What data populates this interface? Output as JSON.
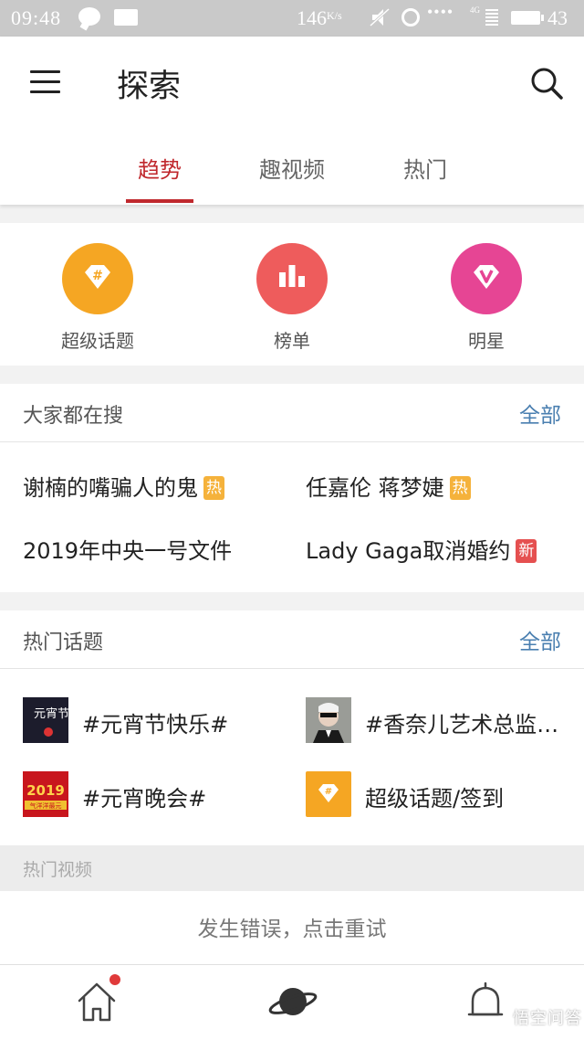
{
  "status_bar": {
    "time": "09:48",
    "net_speed": "146",
    "net_speed_unit": "K/s",
    "signal_label": "4G",
    "battery": "43"
  },
  "header": {
    "title": "探索",
    "tabs": [
      {
        "label": "趋势",
        "active": true
      },
      {
        "label": "趣视频",
        "active": false
      },
      {
        "label": "热门",
        "active": false
      }
    ]
  },
  "quick_entries": [
    {
      "label": "超级话题",
      "icon": "hashtag-diamond-icon",
      "color": "#f5a623"
    },
    {
      "label": "榜单",
      "icon": "bar-chart-icon",
      "color": "#ee5c5c"
    },
    {
      "label": "明星",
      "icon": "v-diamond-icon",
      "color": "#e64594"
    }
  ],
  "trending_search": {
    "title": "大家都在搜",
    "all_label": "全部",
    "items": [
      {
        "text": "谢楠的嘴骗人的鬼",
        "badge": "热",
        "badge_type": "hot"
      },
      {
        "text": "任嘉伦 蒋梦婕",
        "badge": "热",
        "badge_type": "hot"
      },
      {
        "text": "2019年中央一号文件",
        "badge": "",
        "badge_type": ""
      },
      {
        "text": "Lady Gaga取消婚约",
        "badge": "新",
        "badge_type": "new"
      }
    ]
  },
  "hot_topics": {
    "title": "热门话题",
    "all_label": "全部",
    "items": [
      {
        "text": "#元宵节快乐#",
        "thumb": "lantern-festival-thumbnail"
      },
      {
        "text": "#香奈儿艺术总监…",
        "thumb": "person-sunglasses-thumbnail"
      },
      {
        "text": "#元宵晚会#",
        "thumb": "2019-gala-thumbnail"
      },
      {
        "text": "超级话题/签到",
        "thumb": "hashtag-diamond-icon"
      }
    ],
    "thumb_texts": {
      "lantern": "元宵节",
      "gala_year": "2019",
      "gala_banner": "气洋洋最元"
    }
  },
  "hot_videos": {
    "title": "热门视频",
    "error_text": "发生错误，点击重试"
  },
  "bottom_nav": [
    {
      "icon": "home-icon",
      "has_dot": true
    },
    {
      "icon": "planet-icon",
      "has_dot": false
    },
    {
      "icon": "bell-icon",
      "has_dot": false
    }
  ],
  "watermark": "悟空问答",
  "colors": {
    "accent": "#c0282d",
    "link": "#4a7fb0",
    "hot_badge": "#f5b23b",
    "new_badge": "#e55050"
  }
}
